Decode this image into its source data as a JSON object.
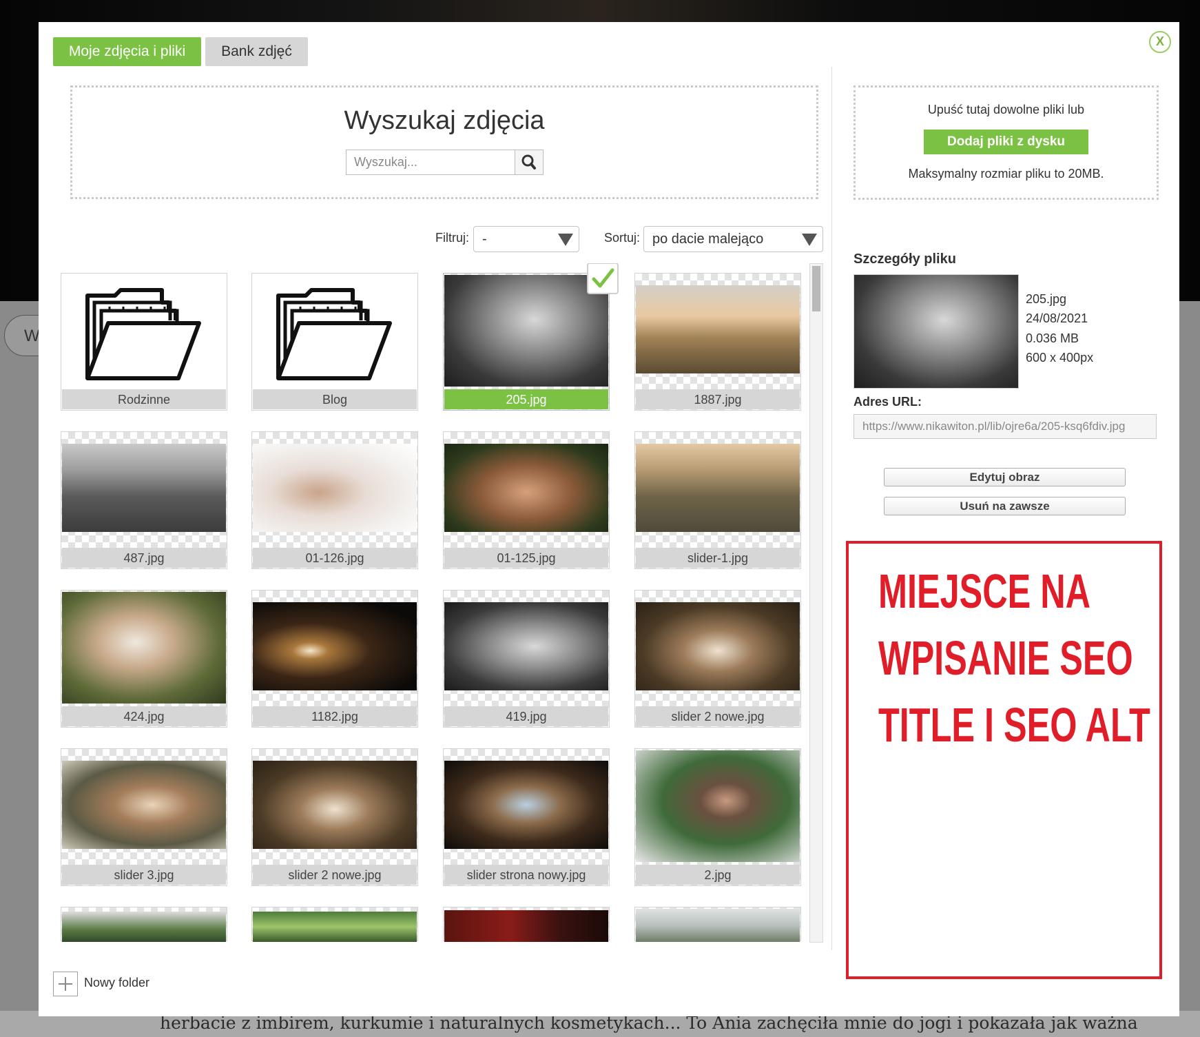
{
  "background": {
    "pill_text": "W",
    "bottom_text": "herbacie z imbirem, kurkumie i naturalnych kosmetykach... To Ania zachęciła mnie do jogi i pokazała jak ważna"
  },
  "modal": {
    "close_label": "X",
    "tabs": [
      {
        "label": "Moje zdjęcia i pliki",
        "active": true
      },
      {
        "label": "Bank zdjęć",
        "active": false
      }
    ],
    "search": {
      "title": "Wyszukaj zdjęcia",
      "placeholder": "Wyszukaj...",
      "button_icon": "search-icon"
    },
    "filter": {
      "label": "Filtruj:",
      "value": "-"
    },
    "sort": {
      "label": "Sortuj:",
      "value": "po dacie malejąco"
    },
    "files": [
      {
        "name": "Rodzinne",
        "type": "folder"
      },
      {
        "name": "Blog",
        "type": "folder"
      },
      {
        "name": "205.jpg",
        "type": "image",
        "selected": true
      },
      {
        "name": "1887.jpg",
        "type": "image"
      },
      {
        "name": "487.jpg",
        "type": "image"
      },
      {
        "name": "01-126.jpg",
        "type": "image"
      },
      {
        "name": "01-125.jpg",
        "type": "image"
      },
      {
        "name": "slider-1.jpg",
        "type": "image"
      },
      {
        "name": "424.jpg",
        "type": "image"
      },
      {
        "name": "1182.jpg",
        "type": "image"
      },
      {
        "name": "419.jpg",
        "type": "image"
      },
      {
        "name": "slider 2 nowe.jpg",
        "type": "image"
      },
      {
        "name": "slider 3.jpg",
        "type": "image"
      },
      {
        "name": "slider 2 nowe.jpg",
        "type": "image"
      },
      {
        "name": "slider strona nowy.jpg",
        "type": "image"
      },
      {
        "name": "2.jpg",
        "type": "image"
      }
    ],
    "new_folder_label": "Nowy folder",
    "upload": {
      "drop_text": "Upuść tutaj dowolne pliki lub",
      "button_label": "Dodaj pliki z dysku",
      "max_size_text": "Maksymalny rozmiar pliku to 20MB."
    },
    "details": {
      "title": "Szczegóły pliku",
      "filename": "205.jpg",
      "date": "24/08/2021",
      "size": "0.036 MB",
      "dimensions": "600 x 400px",
      "url_label": "Adres URL:",
      "url": "https://www.nikawiton.pl/lib/ojre6a/205-ksq6fdiv.jpg",
      "edit_label": "Edytuj obraz",
      "delete_label": "Usuń na zawsze"
    },
    "annotation": {
      "lines": [
        "MIEJSCE NA",
        "WPISANIE SEO",
        "TITLE I SEO ALT"
      ],
      "color": "#e01e29"
    },
    "colors": {
      "accent": "#7bc244",
      "tab_inactive": "#d6d6d6"
    }
  }
}
